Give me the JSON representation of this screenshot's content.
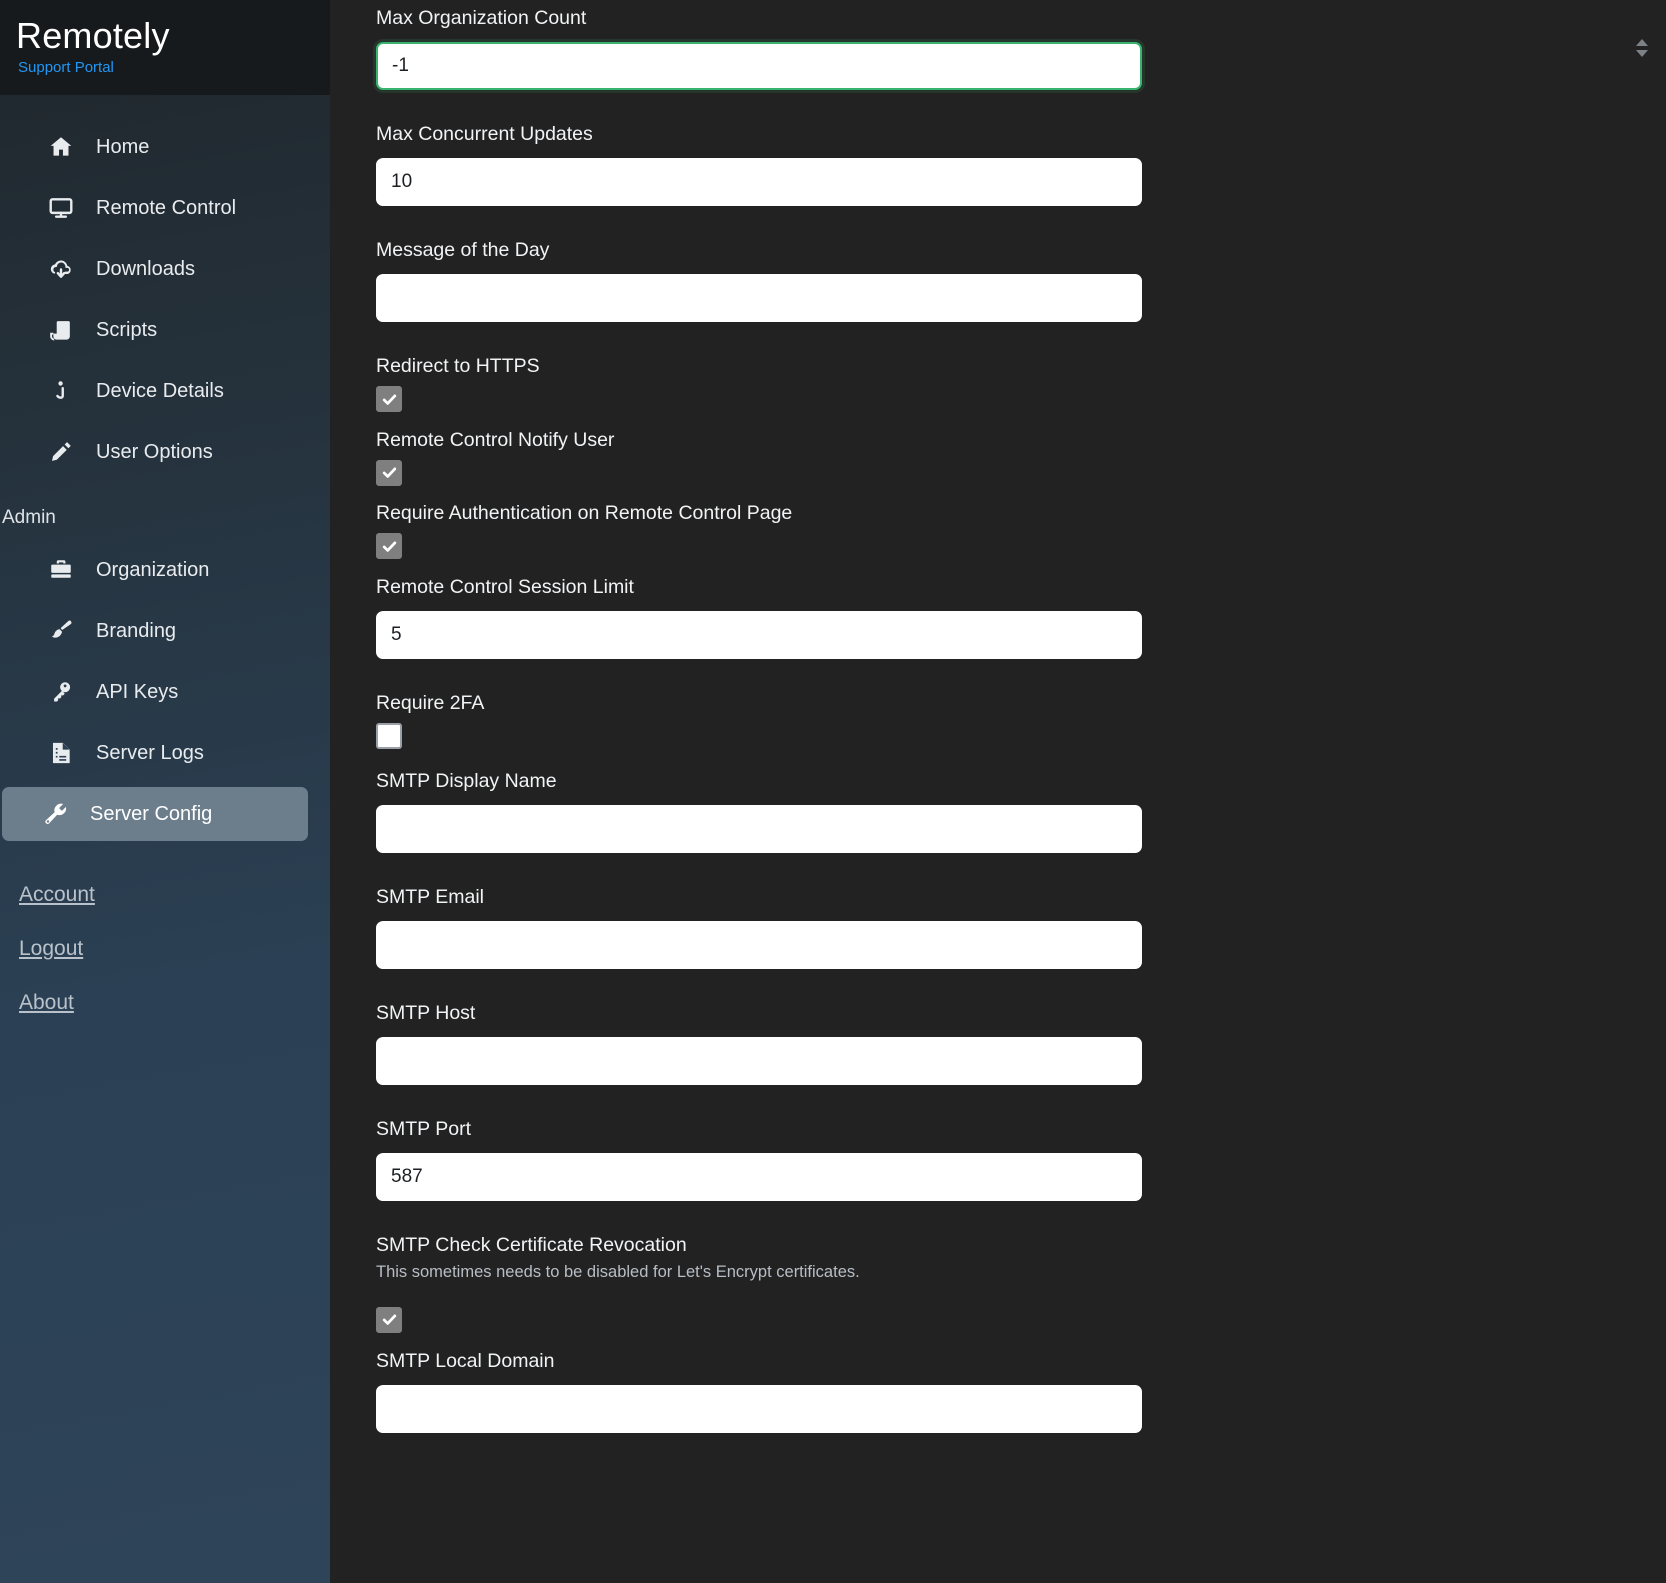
{
  "sidebar": {
    "brand_title": "Remotely",
    "brand_subtitle": "Support Portal",
    "nav_items": [
      {
        "label": "Home",
        "icon": "home-icon"
      },
      {
        "label": "Remote Control",
        "icon": "monitor-icon"
      },
      {
        "label": "Downloads",
        "icon": "cloud-download-icon"
      },
      {
        "label": "Scripts",
        "icon": "script-icon"
      },
      {
        "label": "Device Details",
        "icon": "info-icon"
      },
      {
        "label": "User Options",
        "icon": "pencil-icon"
      }
    ],
    "admin_section_title": "Admin",
    "admin_items": [
      {
        "label": "Organization",
        "icon": "briefcase-icon",
        "active": false
      },
      {
        "label": "Branding",
        "icon": "paintbrush-icon",
        "active": false
      },
      {
        "label": "API Keys",
        "icon": "key-icon",
        "active": false
      },
      {
        "label": "Server Logs",
        "icon": "document-log-icon",
        "active": false
      },
      {
        "label": "Server Config",
        "icon": "wrench-icon",
        "active": true
      }
    ],
    "footer_links": [
      {
        "label": "Account"
      },
      {
        "label": "Logout"
      },
      {
        "label": "About"
      }
    ]
  },
  "form": {
    "fields": [
      {
        "type": "number",
        "label": "Max Organization Count",
        "value": "-1",
        "focused": true,
        "has_spinner": true
      },
      {
        "type": "number",
        "label": "Max Concurrent Updates",
        "value": "10",
        "focused": false,
        "has_spinner": false
      },
      {
        "type": "text",
        "label": "Message of the Day",
        "value": "",
        "focused": false,
        "has_spinner": false
      },
      {
        "type": "checkbox",
        "label": "Redirect to HTTPS",
        "checked": true
      },
      {
        "type": "checkbox",
        "label": "Remote Control Notify User",
        "checked": true
      },
      {
        "type": "checkbox",
        "label": "Require Authentication on Remote Control Page",
        "checked": true
      },
      {
        "type": "number",
        "label": "Remote Control Session Limit",
        "value": "5",
        "focused": false,
        "has_spinner": false
      },
      {
        "type": "checkbox",
        "label": "Require 2FA",
        "checked": false
      },
      {
        "type": "text",
        "label": "SMTP Display Name",
        "value": "",
        "focused": false,
        "has_spinner": false
      },
      {
        "type": "text",
        "label": "SMTP Email",
        "value": "",
        "focused": false,
        "has_spinner": false
      },
      {
        "type": "text",
        "label": "SMTP Host",
        "value": "",
        "focused": false,
        "has_spinner": false
      },
      {
        "type": "number",
        "label": "SMTP Port",
        "value": "587",
        "focused": false,
        "has_spinner": false
      },
      {
        "type": "checkbox",
        "label": "SMTP Check Certificate Revocation",
        "help": "This sometimes needs to be disabled for Let's Encrypt certificates.",
        "checked": true
      },
      {
        "type": "text",
        "label": "SMTP Local Domain",
        "value": "",
        "focused": false,
        "has_spinner": false
      }
    ]
  },
  "colors": {
    "sidebar_top": "#171a1d",
    "sidebar_bottom": "#2e4459",
    "content_bg": "#222222",
    "accent_blue": "#2196f3",
    "focus_green": "#3ab36e",
    "active_nav": "#6c7d8c",
    "checkbox_checked": "#7f7f7f"
  }
}
